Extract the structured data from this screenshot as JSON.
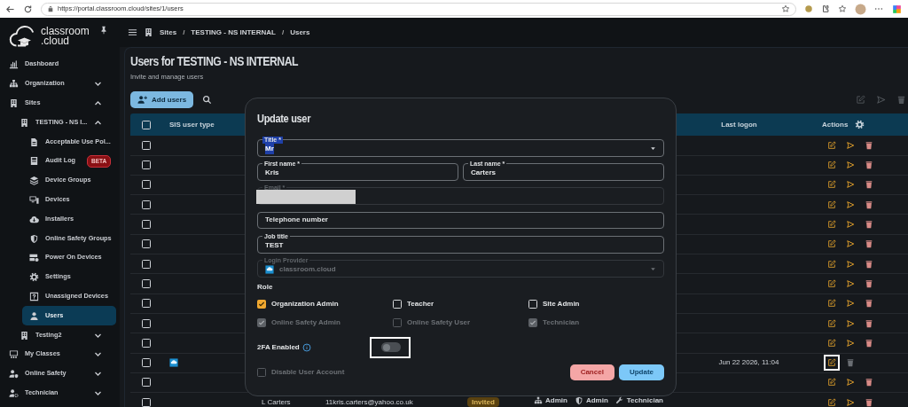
{
  "browser": {
    "url": "https://portal.classroom.cloud/sites/1/users"
  },
  "sidebar": {
    "logo": [
      "classroom",
      ".cloud"
    ],
    "items": [
      {
        "label": "Dashboard",
        "selected": false
      },
      {
        "label": "Organization",
        "selected": false,
        "expanded": false
      },
      {
        "label": "Sites",
        "selected": false,
        "expanded": true,
        "children": [
          {
            "label": "TESTING - NS I...",
            "selected": false,
            "expanded": true,
            "children": [
              {
                "label": "Acceptable Use Pol...",
                "selected": false
              },
              {
                "label": "Audit Log",
                "selected": false,
                "badge": "BETA"
              },
              {
                "label": "Device Groups",
                "selected": false
              },
              {
                "label": "Devices",
                "selected": false
              },
              {
                "label": "Installers",
                "selected": false
              },
              {
                "label": "Online Safety Groups",
                "selected": false
              },
              {
                "label": "Power On Devices",
                "selected": false
              },
              {
                "label": "Settings",
                "selected": false
              },
              {
                "label": "Unassigned Devices",
                "selected": false
              },
              {
                "label": "Users",
                "selected": true
              }
            ]
          },
          {
            "label": "Testing2",
            "selected": false,
            "expanded": false
          }
        ]
      },
      {
        "label": "My Classes",
        "selected": false,
        "expanded": false
      },
      {
        "label": "Online Safety",
        "selected": false,
        "expanded": false
      },
      {
        "label": "Technician",
        "selected": false,
        "expanded": false
      }
    ]
  },
  "breadcrumb": {
    "items": [
      "Sites",
      "TESTING - NS INTERNAL",
      "Users"
    ],
    "separator": "/"
  },
  "page": {
    "title": "Users for TESTING - NS INTERNAL",
    "subtitle": "Invite and manage users"
  },
  "toolbar": {
    "add_button": "Add users",
    "bulk_actions_disabled": true
  },
  "table": {
    "all_selected": false,
    "headers": {
      "sis_user_type": "SIS user type",
      "last_logon": "Last logon",
      "actions": "Actions"
    },
    "rows": [
      {
        "selected": false,
        "sis_linked": false,
        "can_resend": true,
        "delete_enabled": true,
        "edit_highlighted": false
      },
      {
        "selected": false,
        "sis_linked": false,
        "can_resend": true,
        "delete_enabled": true,
        "edit_highlighted": false
      },
      {
        "selected": false,
        "sis_linked": false,
        "can_resend": true,
        "delete_enabled": true,
        "edit_highlighted": false
      },
      {
        "selected": false,
        "sis_linked": false,
        "can_resend": true,
        "delete_enabled": true,
        "edit_highlighted": false
      },
      {
        "selected": false,
        "sis_linked": false,
        "can_resend": true,
        "delete_enabled": true,
        "edit_highlighted": false
      },
      {
        "selected": false,
        "sis_linked": false,
        "can_resend": true,
        "delete_enabled": true,
        "edit_highlighted": false
      },
      {
        "selected": false,
        "sis_linked": false,
        "can_resend": true,
        "delete_enabled": true,
        "edit_highlighted": false
      },
      {
        "selected": false,
        "sis_linked": false,
        "can_resend": true,
        "delete_enabled": true,
        "edit_highlighted": false
      },
      {
        "selected": false,
        "sis_linked": false,
        "can_resend": true,
        "delete_enabled": true,
        "edit_highlighted": false
      },
      {
        "selected": false,
        "sis_linked": false,
        "can_resend": true,
        "delete_enabled": true,
        "edit_highlighted": false
      },
      {
        "selected": false,
        "sis_linked": false,
        "can_resend": true,
        "delete_enabled": true,
        "edit_highlighted": false
      },
      {
        "selected": false,
        "sis_linked": true,
        "last_logon": "Jun 22 2026, 11:04",
        "can_resend": false,
        "delete_enabled": false,
        "edit_highlighted": true
      },
      {
        "selected": false,
        "sis_linked": false,
        "can_resend": true,
        "delete_enabled": true,
        "edit_highlighted": false
      },
      {
        "selected": false,
        "sis_linked": false,
        "name": "L Carters",
        "email": "11kris.carters@yahoo.co.uk",
        "status": "Invited",
        "roles": [
          "Admin",
          "Admin",
          "Technician"
        ],
        "can_resend": true,
        "delete_enabled": true,
        "edit_highlighted": false
      }
    ]
  },
  "dialog": {
    "title": "Update user",
    "fields": {
      "title": {
        "label": "Title *",
        "value": "Mr",
        "highlighted": true
      },
      "first_name": {
        "label": "First name *",
        "value": "Kris"
      },
      "last_name": {
        "label": "Last name *",
        "value": "Carters"
      },
      "email": {
        "label": "Email *",
        "disabled": true
      },
      "telephone": {
        "placeholder": "Telephone number"
      },
      "job_title": {
        "label": "Job title",
        "value": "TEST"
      },
      "login_provider": {
        "label": "Login Provider",
        "value": "classroom.cloud",
        "disabled": true
      }
    },
    "role_heading": "Role",
    "roles": [
      {
        "label": "Organization Admin",
        "checked": true,
        "disabled": false
      },
      {
        "label": "Teacher",
        "checked": false,
        "disabled": false
      },
      {
        "label": "Site Admin",
        "checked": false,
        "disabled": false
      },
      {
        "label": "Online Safety Admin",
        "checked": true,
        "disabled": true
      },
      {
        "label": "Online Safety User",
        "checked": false,
        "disabled": true
      },
      {
        "label": "Technician",
        "checked": true,
        "disabled": true
      }
    ],
    "two_factor": {
      "label": "2FA Enabled",
      "on": false,
      "highlighted": true
    },
    "disable_account": {
      "label": "Disable User Account",
      "checked": false,
      "disabled": true
    },
    "buttons": [
      {
        "label": "Cancel",
        "kind": "cancel"
      },
      {
        "label": "Update",
        "kind": "primary"
      }
    ]
  }
}
